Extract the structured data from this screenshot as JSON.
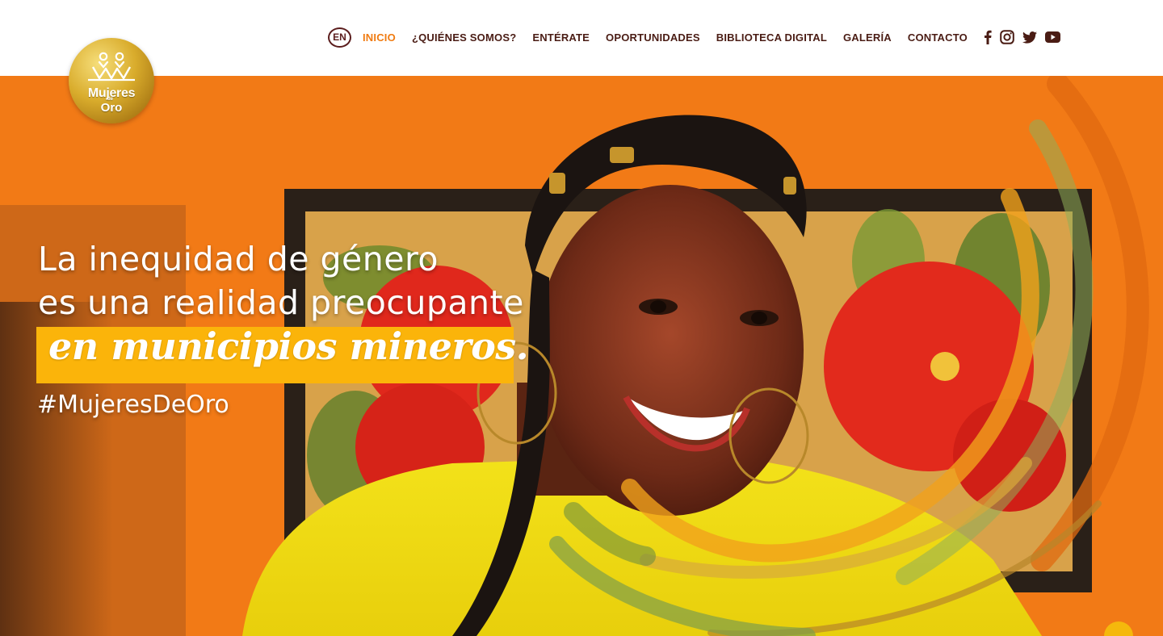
{
  "brand": {
    "logo_line1": "Mujeres",
    "logo_small": "de",
    "logo_line2": "Oro",
    "gold": "#d9ac2c"
  },
  "nav": {
    "lang_toggle": "EN",
    "items": [
      "INICIO",
      "¿QUIÉNES SOMOS?",
      "ENTÉRATE",
      "OPORTUNIDADES",
      "BIBLIOTECA DIGITAL",
      "GALERÍA",
      "CONTACTO"
    ],
    "active": "INICIO",
    "active_color": "#f07b11",
    "text_color": "#4a1c14"
  },
  "social": [
    "facebook-icon",
    "instagram-icon",
    "twitter-icon",
    "youtube-icon"
  ],
  "hero": {
    "line1": "La inequidad de género",
    "line2": "es una realidad preocupante",
    "highlight": "en municipios mineros.",
    "hashtag": "#MujeresDeOro",
    "background_color": "#f27d18",
    "highlight_color": "#fbb40a"
  }
}
